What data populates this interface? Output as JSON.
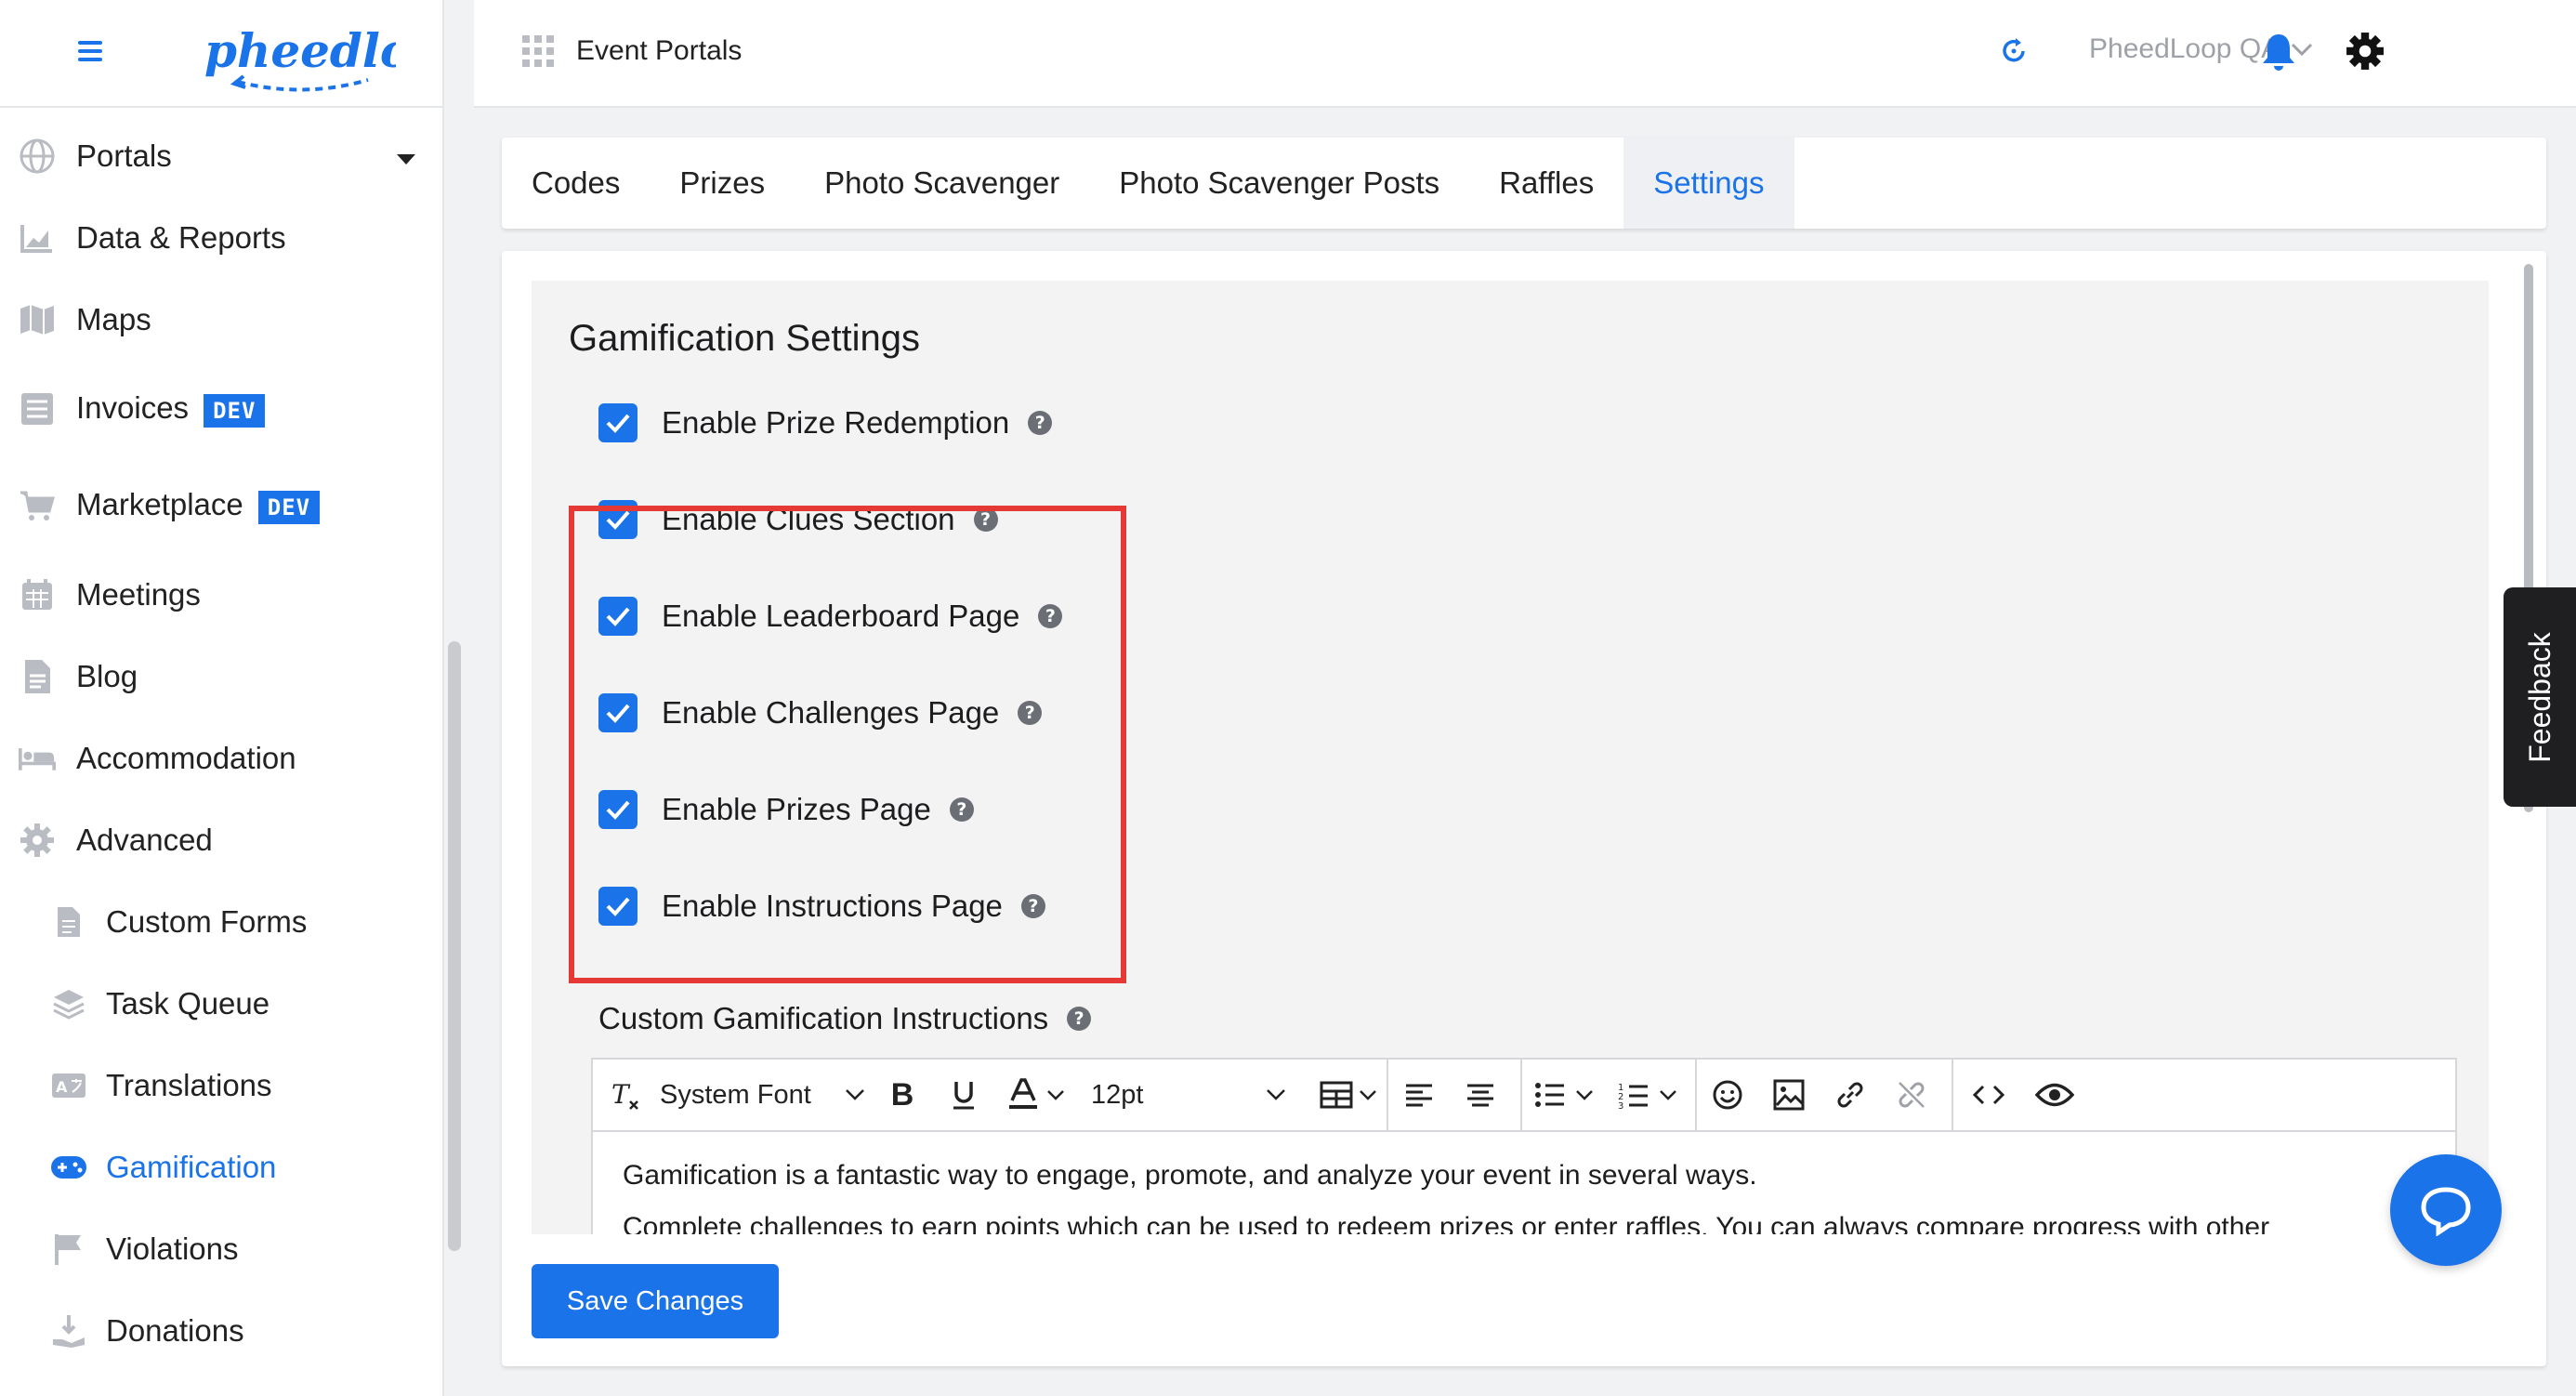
{
  "header": {
    "title": "Event Portals",
    "org_name": "PheedLoop QA"
  },
  "logo": {
    "text": "pheedloop"
  },
  "sidebar": {
    "items": [
      {
        "label": "Portals",
        "icon": "globe-icon"
      },
      {
        "label": "Data & Reports",
        "icon": "chart-icon"
      },
      {
        "label": "Maps",
        "icon": "map-icon"
      },
      {
        "label": "Invoices",
        "icon": "invoice-icon",
        "badge": "DEV"
      },
      {
        "label": "Marketplace",
        "icon": "cart-icon",
        "badge": "DEV"
      },
      {
        "label": "Meetings",
        "icon": "calendar-icon"
      },
      {
        "label": "Blog",
        "icon": "document-icon"
      },
      {
        "label": "Accommodation",
        "icon": "bed-icon"
      },
      {
        "label": "Advanced",
        "icon": "gear-icon"
      }
    ],
    "subitems": [
      {
        "label": "Custom Forms",
        "icon": "form-icon"
      },
      {
        "label": "Task Queue",
        "icon": "layers-icon"
      },
      {
        "label": "Translations",
        "icon": "translate-icon"
      },
      {
        "label": "Gamification",
        "icon": "gamepad-icon",
        "active": true
      },
      {
        "label": "Violations",
        "icon": "flag-icon"
      },
      {
        "label": "Donations",
        "icon": "donation-icon"
      }
    ]
  },
  "tabs": [
    {
      "label": "Codes"
    },
    {
      "label": "Prizes"
    },
    {
      "label": "Photo Scavenger"
    },
    {
      "label": "Photo Scavenger Posts"
    },
    {
      "label": "Raffles"
    },
    {
      "label": "Settings",
      "active": true
    }
  ],
  "settings": {
    "title": "Gamification Settings",
    "checkboxes": [
      {
        "label": "Enable Prize Redemption",
        "checked": true
      },
      {
        "label": "Enable Clues Section",
        "checked": true
      },
      {
        "label": "Enable Leaderboard Page",
        "checked": true
      },
      {
        "label": "Enable Challenges Page",
        "checked": true
      },
      {
        "label": "Enable Prizes Page",
        "checked": true
      },
      {
        "label": "Enable Instructions Page",
        "checked": true
      }
    ],
    "instructions_label": "Custom Gamification Instructions",
    "help_glyph": "?"
  },
  "editor": {
    "font_family": "System Font",
    "font_size": "12pt",
    "paragraph_1": "Gamification is a fantastic way to engage, promote, and analyze your event in several ways.",
    "paragraph_2": "Complete challenges to earn points which can be used to redeem prizes or enter raffles. You can always compare progress with other"
  },
  "save_button": "Save Changes",
  "feedback_tab": "Feedback",
  "colors": {
    "accent": "#1a73e8",
    "highlight": "#e53935",
    "sidebar_text": "#222222"
  }
}
